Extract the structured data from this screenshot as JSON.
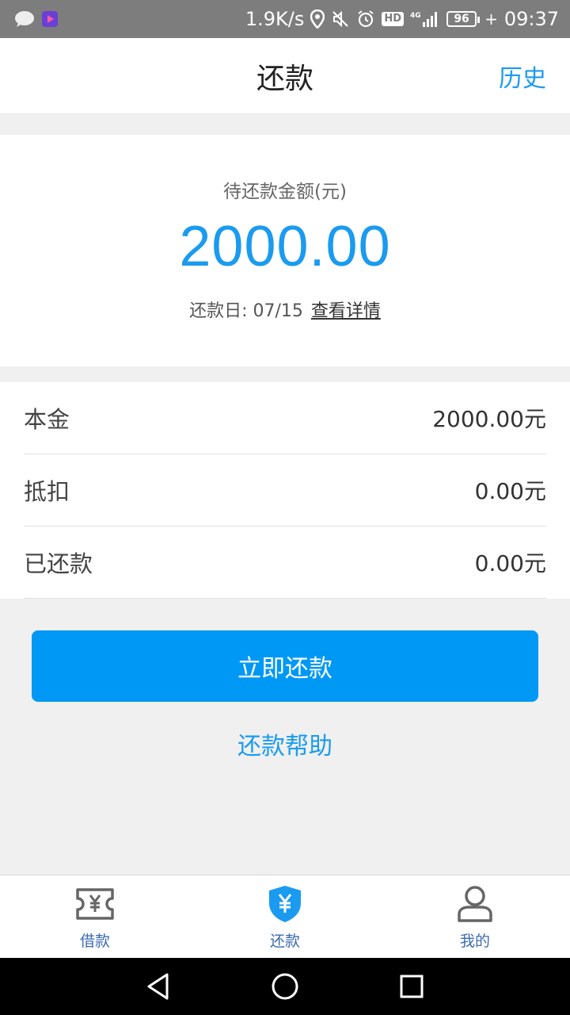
{
  "status_bar": {
    "network_speed": "1.9K/s",
    "hd": "HD",
    "network_type": "4G",
    "battery": "96",
    "time": "09:37"
  },
  "header": {
    "title": "还款",
    "history": "历史"
  },
  "summary": {
    "label": "待还款金额(元)",
    "amount": "2000.00",
    "due_prefix": "还款日: 07/15",
    "details_link": "查看详情"
  },
  "details": [
    {
      "label": "本金",
      "value": "2000.00元"
    },
    {
      "label": "抵扣",
      "value": "0.00元"
    },
    {
      "label": "已还款",
      "value": "0.00元"
    }
  ],
  "actions": {
    "repay_now": "立即还款",
    "repay_help": "还款帮助"
  },
  "tabs": [
    {
      "label": "借款",
      "icon": "ticket-yen-icon",
      "active": false
    },
    {
      "label": "还款",
      "icon": "shield-yen-icon",
      "active": true
    },
    {
      "label": "我的",
      "icon": "person-icon",
      "active": false
    }
  ],
  "colors": {
    "accent": "#1a9bf0",
    "button": "#0098f5",
    "tab_label": "#3b6bb3"
  }
}
